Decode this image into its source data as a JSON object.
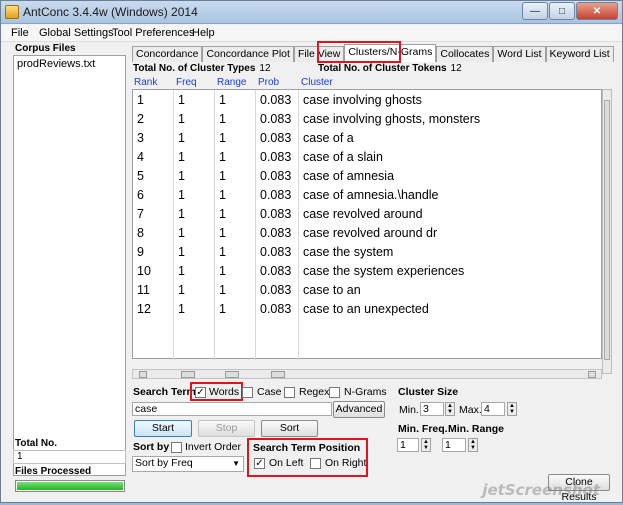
{
  "window": {
    "title": "AntConc 3.4.4w (Windows) 2014"
  },
  "menu": [
    "File",
    "Global Settings",
    "Tool Preferences",
    "Help"
  ],
  "left": {
    "corpus_files_label": "Corpus Files",
    "files": [
      "prodReviews.txt"
    ],
    "total_label": "Total No.",
    "total_value": "1",
    "files_processed_label": "Files Processed",
    "progress": 1.0
  },
  "tabs": [
    "Concordance",
    "Concordance Plot",
    "File View",
    "Clusters/N-Grams",
    "Collocates",
    "Word List",
    "Keyword List"
  ],
  "stats": {
    "types_label": "Total No. of Cluster Types",
    "types_value": "12",
    "tokens_label": "Total No. of Cluster Tokens",
    "tokens_value": "12"
  },
  "columns": [
    "Rank",
    "Freq",
    "Range",
    "Prob",
    "Cluster"
  ],
  "rows": [
    [
      "1",
      "1",
      "1",
      "0.083",
      "case involving ghosts"
    ],
    [
      "2",
      "1",
      "1",
      "0.083",
      "case involving ghosts, monsters"
    ],
    [
      "3",
      "1",
      "1",
      "0.083",
      "case of a"
    ],
    [
      "4",
      "1",
      "1",
      "0.083",
      "case of a slain"
    ],
    [
      "5",
      "1",
      "1",
      "0.083",
      "case of amnesia"
    ],
    [
      "6",
      "1",
      "1",
      "0.083",
      "case of amnesia.\\handle"
    ],
    [
      "7",
      "1",
      "1",
      "0.083",
      "case revolved around"
    ],
    [
      "8",
      "1",
      "1",
      "0.083",
      "case revolved around dr"
    ],
    [
      "9",
      "1",
      "1",
      "0.083",
      "case the system"
    ],
    [
      "10",
      "1",
      "1",
      "0.083",
      "case the system experiences"
    ],
    [
      "11",
      "1",
      "1",
      "0.083",
      "case to an"
    ],
    [
      "12",
      "1",
      "1",
      "0.083",
      "case to an unexpected"
    ]
  ],
  "controls": {
    "search_term_label": "Search Term",
    "words_label": "Words",
    "case_label": "Case",
    "regex_label": "Regex",
    "ngrams_label": "N-Grams",
    "search_value": "case",
    "advanced_label": "Advanced",
    "cluster_size_label": "Cluster Size",
    "min_label": "Min.",
    "min_value": "3",
    "max_label": "Max.",
    "max_value": "4",
    "start_label": "Start",
    "stop_label": "Stop",
    "sort_label": "Sort",
    "min_freq_label": "Min. Freq.",
    "min_freq_value": "1",
    "min_range_label": "Min. Range",
    "min_range_value": "1",
    "sort_by_label": "Sort by",
    "invert_order_label": "Invert Order",
    "sort_by_value": "Sort by Freq",
    "position_label": "Search Term Position",
    "on_left_label": "On Left",
    "on_right_label": "On Right",
    "clone_label": "Clone Results"
  },
  "watermark": "jetScreenshot"
}
